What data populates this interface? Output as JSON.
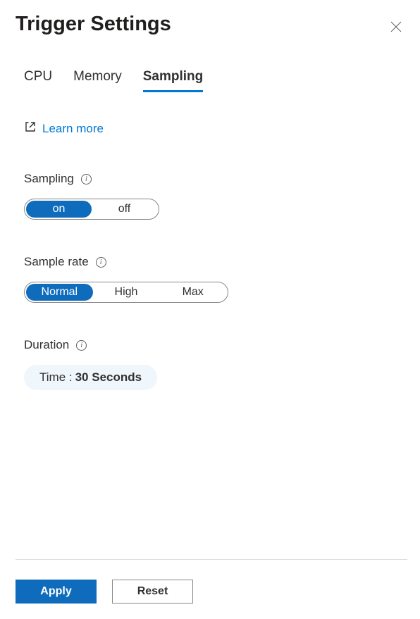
{
  "header": {
    "title": "Trigger Settings"
  },
  "tabs": {
    "items": [
      {
        "label": "CPU"
      },
      {
        "label": "Memory"
      },
      {
        "label": "Sampling"
      }
    ]
  },
  "learn_more": {
    "label": "Learn more"
  },
  "sampling": {
    "label": "Sampling",
    "options": {
      "on": "on",
      "off": "off"
    }
  },
  "sample_rate": {
    "label": "Sample rate",
    "options": {
      "normal": "Normal",
      "high": "High",
      "max": "Max"
    }
  },
  "duration": {
    "label": "Duration",
    "prefix": "Time : ",
    "value": "30 Seconds"
  },
  "footer": {
    "apply": "Apply",
    "reset": "Reset"
  }
}
